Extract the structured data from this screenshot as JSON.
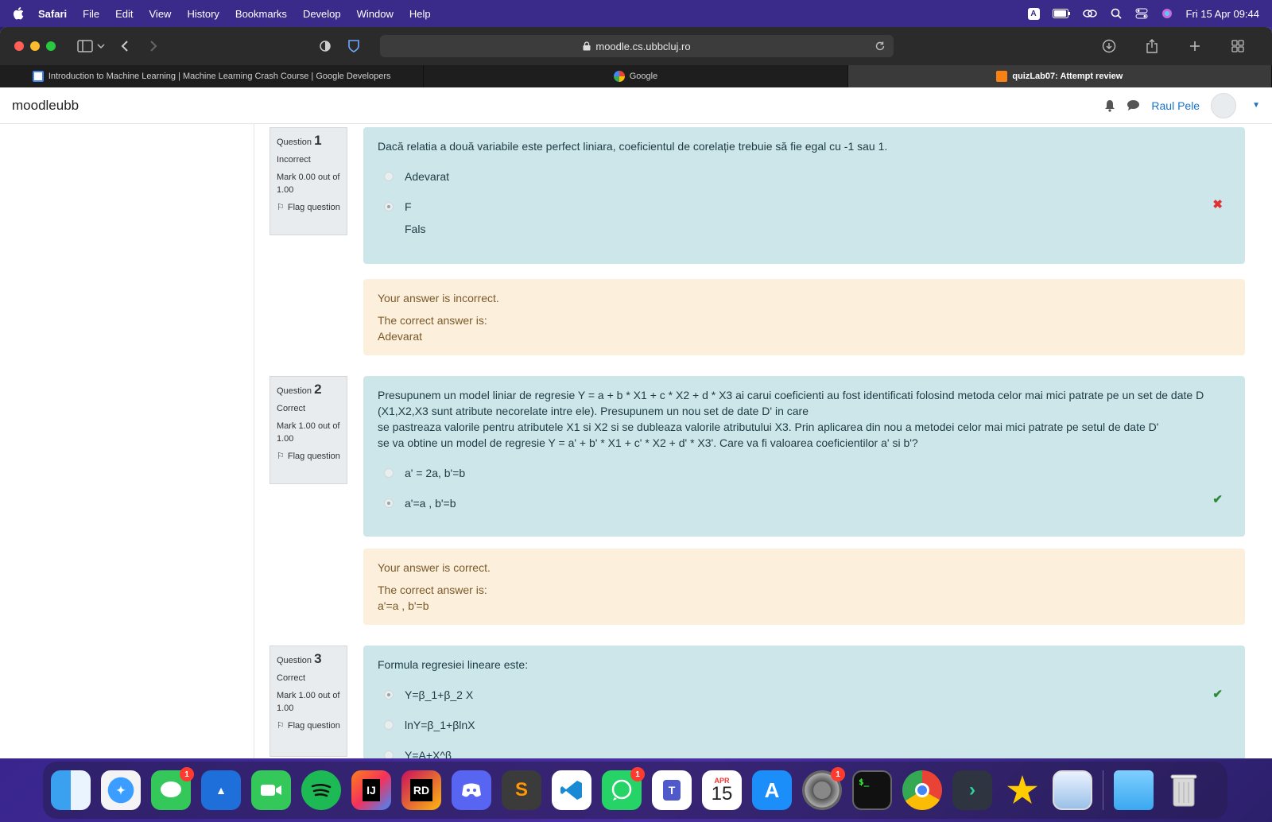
{
  "menubar": {
    "app": "Safari",
    "items": [
      "File",
      "Edit",
      "View",
      "History",
      "Bookmarks",
      "Develop",
      "Window",
      "Help"
    ],
    "datetime": "Fri 15 Apr  09:44",
    "input_badge": "A"
  },
  "browser": {
    "url": "moodle.cs.ubbcluj.ro",
    "tabs": [
      "Introduction to Machine Learning  |  Machine Learning Crash Course  |  Google Developers",
      "Google",
      "quizLab07: Attempt review"
    ]
  },
  "moodle": {
    "brand": "moodleubb",
    "user": "Raul Pele"
  },
  "questions": [
    {
      "label": "Question",
      "number": "1",
      "state": "Incorrect",
      "mark": "Mark 0.00 out of 1.00",
      "flag": "Flag question",
      "text": "Dacă relatia a două variabile este perfect liniara, coeficientul de corelație trebuie să fie egal cu -1 sau 1.",
      "answers": [
        {
          "label": "Adevarat",
          "sub": ""
        },
        {
          "label": "F",
          "sub": "Fals"
        }
      ],
      "feedback_result": "Your answer is incorrect.",
      "feedback_label": "The correct answer is:",
      "feedback_answer": "Adevarat"
    },
    {
      "label": "Question",
      "number": "2",
      "state": "Correct",
      "mark": "Mark 1.00 out of 1.00",
      "flag": "Flag question",
      "text_lines": [
        "Presupunem un model liniar de regresie Y = a + b * X1 + c * X2 + d * X3 ai carui coeficienti au fost identificati folosind metoda celor mai mici patrate pe un set de date D (X1,X2,X3 sunt atribute necorelate intre ele). Presupunem un nou set de date D' in care",
        "se pastreaza valorile pentru atributele X1 si X2 si se dubleaza valorile atributului X3. Prin aplicarea din nou a metodei celor mai mici patrate pe setul de date D'",
        "se va obtine un model de regresie Y = a' + b' * X1 + c' * X2 + d' * X3'. Care va fi valoarea coeficientilor a' si b'?"
      ],
      "answers": [
        {
          "label": "a' = 2a, b'=b"
        },
        {
          "label": "a'=a , b'=b"
        }
      ],
      "feedback_result": "Your answer is correct.",
      "feedback_label": "The correct answer is:",
      "feedback_answer": "a'=a , b'=b"
    },
    {
      "label": "Question",
      "number": "3",
      "state": "Correct",
      "mark": "Mark 1.00 out of 1.00",
      "flag": "Flag question",
      "text": "Formula regresiei lineare este:",
      "answers": [
        {
          "label": "Y=β_1+β_2 X"
        },
        {
          "label": "lnY=β_1+βlnX"
        },
        {
          "label": "Y=A+X^β"
        }
      ]
    }
  ],
  "dock": {
    "badges": {
      "messages": "1",
      "whatsapp": "1",
      "settings": "1"
    },
    "calendar_month": "APR",
    "calendar_day": "15"
  }
}
